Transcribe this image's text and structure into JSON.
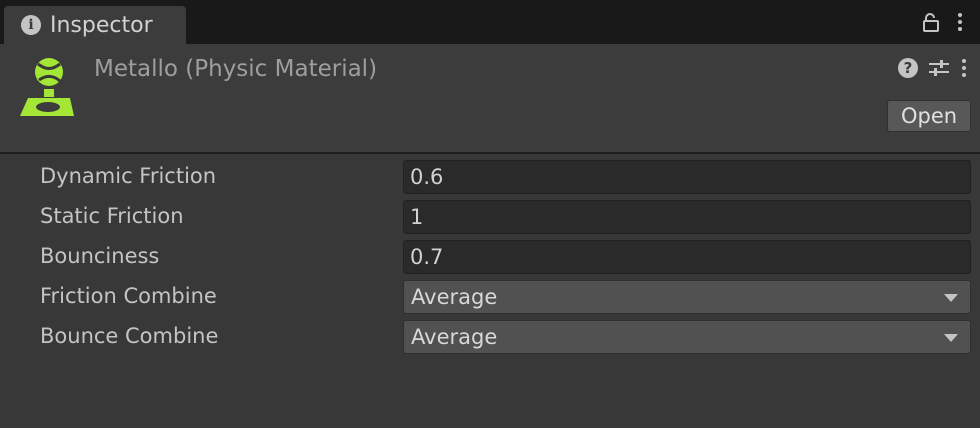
{
  "tab": {
    "label": "Inspector",
    "icon": "info-icon"
  },
  "header": {
    "title": "Metallo (Physic Material)",
    "open_label": "Open",
    "icons": [
      "physic-material-icon",
      "help-icon",
      "settings-sliders-icon",
      "kebab-menu-icon"
    ],
    "accent": "#a3e635"
  },
  "properties": [
    {
      "label": "Dynamic Friction",
      "value": "0.6",
      "kind": "field"
    },
    {
      "label": "Static Friction",
      "value": "1",
      "kind": "field"
    },
    {
      "label": "Bounciness",
      "value": "0.7",
      "kind": "field"
    },
    {
      "label": "Friction Combine",
      "value": "Average",
      "kind": "dropdown"
    },
    {
      "label": "Bounce Combine",
      "value": "Average",
      "kind": "dropdown"
    }
  ]
}
